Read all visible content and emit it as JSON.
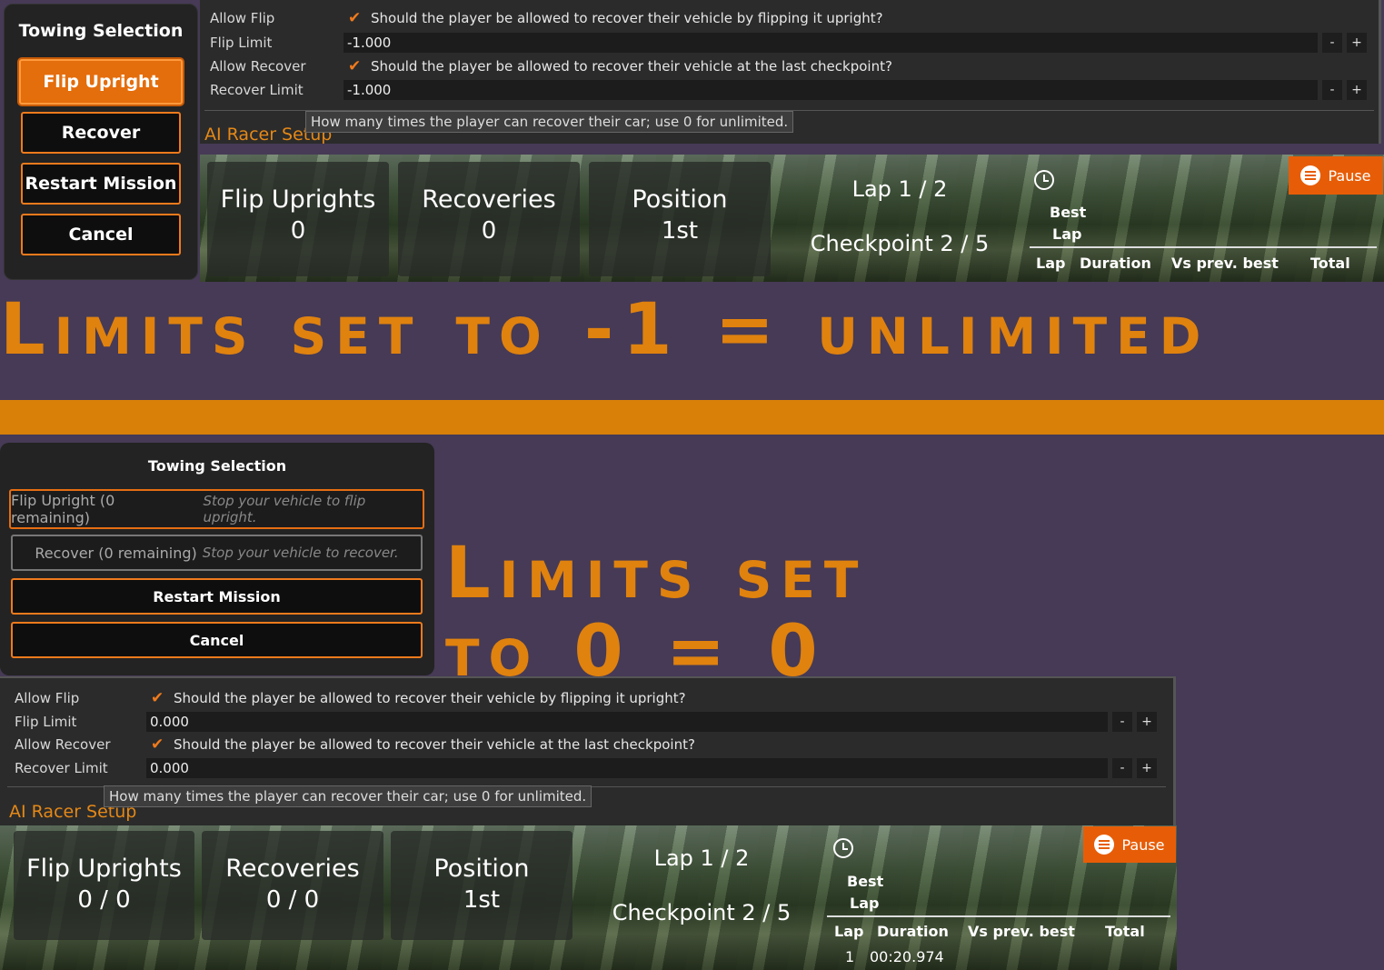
{
  "top": {
    "dialog": {
      "title": "Towing Selection",
      "buttons": [
        "Flip Upright",
        "Recover",
        "Restart Mission",
        "Cancel"
      ]
    },
    "settings": {
      "allow_flip_label": "Allow Flip",
      "allow_flip_desc": "Should the player be allowed to recover their vehicle by flipping it upright?",
      "flip_limit_label": "Flip Limit",
      "flip_limit_value": "-1.000",
      "allow_recover_label": "Allow Recover",
      "allow_recover_desc": "Should the player be allowed to recover their vehicle at the last checkpoint?",
      "recover_limit_label": "Recover Limit",
      "recover_limit_value": "-1.000",
      "minus": "-",
      "plus": "+",
      "tooltip": "How many times the player can recover their car; use 0 for unlimited.",
      "section": "AI Racer Setup"
    },
    "hud": {
      "flip_title": "Flip Uprights",
      "flip_value": "0",
      "rec_title": "Recoveries",
      "rec_value": "0",
      "pos_title": "Position",
      "pos_value": "1st",
      "lap": "Lap 1 / 2",
      "checkpoint": "Checkpoint 2 / 5",
      "pause": "Pause",
      "best": "Best",
      "best_lap": "Lap",
      "cols": [
        "Lap",
        "Duration",
        "Vs prev. best",
        "Total"
      ]
    }
  },
  "caption1": "Limits set to -1 = unlimited",
  "caption2_line1": "Limits set",
  "caption2_line2": "to 0 = 0",
  "bottom": {
    "dialog": {
      "title": "Towing Selection",
      "flip_label": "Flip Upright (0 remaining)",
      "flip_hint": "Stop your vehicle to flip upright.",
      "recover_label": "Recover (0 remaining)",
      "recover_hint": "Stop your vehicle to recover.",
      "restart": "Restart Mission",
      "cancel": "Cancel"
    },
    "settings": {
      "allow_flip_label": "Allow Flip",
      "allow_flip_desc": "Should the player be allowed to recover their vehicle by flipping it upright?",
      "flip_limit_label": "Flip Limit",
      "flip_limit_value": "0.000",
      "allow_recover_label": "Allow Recover",
      "allow_recover_desc": "Should the player be allowed to recover their vehicle at the last checkpoint?",
      "recover_limit_label": "Recover Limit",
      "recover_limit_value": "0.000",
      "minus": "-",
      "plus": "+",
      "tooltip": "How many times the player can recover their car; use 0 for unlimited.",
      "section": "AI Racer Setup"
    },
    "hud": {
      "flip_title": "Flip Uprights",
      "flip_value": "0 / 0",
      "rec_title": "Recoveries",
      "rec_value": "0 / 0",
      "pos_title": "Position",
      "pos_value": "1st",
      "lap": "Lap 1 / 2",
      "checkpoint": "Checkpoint 2 / 5",
      "pause": "Pause",
      "best": "Best",
      "best_lap": "Lap",
      "cols": [
        "Lap",
        "Duration",
        "Vs prev. best",
        "Total"
      ],
      "row_lap": "1",
      "row_duration": "00:20.974"
    }
  },
  "colors": {
    "accent": "#e0820e",
    "background": "#463a56",
    "pause": "#e75d07"
  }
}
